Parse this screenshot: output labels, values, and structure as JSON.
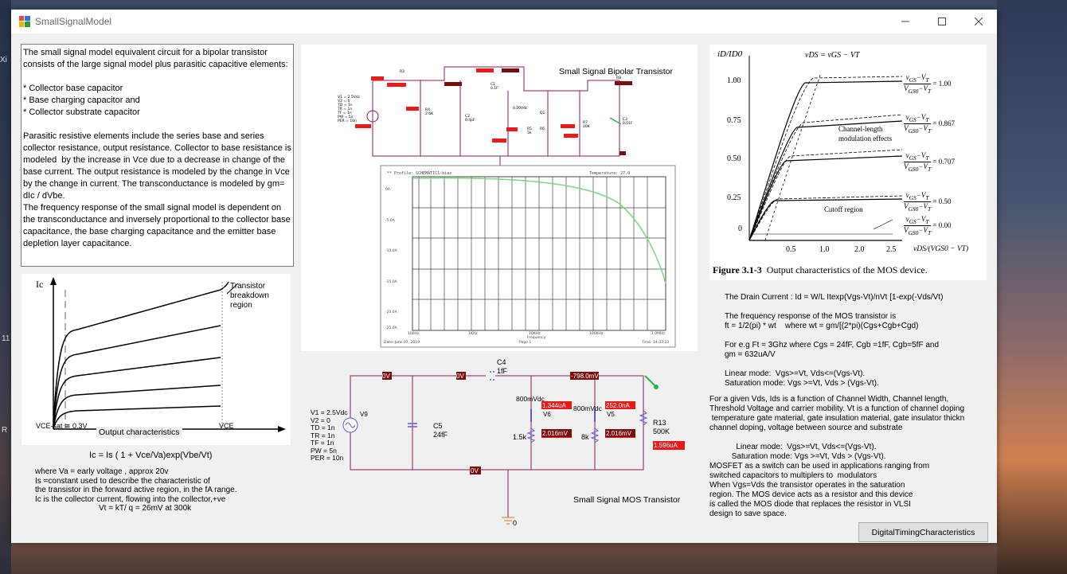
{
  "window": {
    "title": "SmallSignalModel"
  },
  "desktop": {
    "left_labels": [
      "Xi",
      "11",
      "R"
    ]
  },
  "left_text": "The small signal model equivalent circuit for a bipolar transistor consists of the large signal model plus parasitic capacitive elements:\n\n* Collector base capacitor\n* Base charging capacitor and\n* Collector substrate capacitor\n\nParasitic resistive elements include the series base and series collector resistance, output resistance. Collector to base resistance is modeled  by the increase in Vce due to a decrease in change of the base current. The output resistance is modeled by the change in Vce by the change in current. The transconductance is modeled by gm= dIc / dVbe.\nThe frequency response of the small signal model is dependent on the transconductance and inversely proportional to the collector base capacitance, the base charging capacitance and the emitter base depletion layer capacitance.",
  "bjt_graph": {
    "y_label": "Ic",
    "annotation": "Transistor\nbreakdown\nregion",
    "vce_sat": "VCE-sat ≅ 0.3V",
    "x_label": "VCE",
    "caption": "Output characteristics"
  },
  "bjt_notes": {
    "equation": "Ic = Is ( 1 + Vce/Va)exp(Vbe/Vt)",
    "lines": [
      "where Va = early voltage , approx 20v",
      "Is =constant used to describe the characteristic of",
      "the transistor in the forward active region, in the fA range.",
      "Ic is the collector current, flowing into the collector,+ve",
      "Vt = kT/ q = 26mV at 300k"
    ]
  },
  "bjt_circuit": {
    "title": "Small Signal Bipolar Transistor",
    "source_params": "V1 = 2.5Vdc\nV2 = 0\nTD = 1n\nTR = 1n\nTF = 1n\nPW = 5n\nPER = 10n",
    "components": [
      "R3",
      "R4\n2.6K",
      "C1\n0.1F",
      "C2\n0.4pF",
      "0.20Vdc",
      "Q1",
      "R5\n5k",
      "R6",
      "R7\n20K",
      "C3\n0.01F",
      "R8"
    ]
  },
  "simulation_plot": {
    "footer_left": "Date: June 07, 2019",
    "footer_mid": "Page 1",
    "footer_right": "Time: 14:33:23",
    "x_label": "Frequency",
    "x_ticks": [
      "100Hz",
      "1KHz",
      "10KHz",
      "100KHz",
      "1.0MHz"
    ],
    "y_ticks": [
      "0A",
      "-5.0A",
      "-10.0A",
      "-15.0A",
      "-20.0A",
      "-25.0A"
    ]
  },
  "mos_circuit": {
    "title": "Small Signal MOS Transistor",
    "source_params": "V1 = 2.5Vdc\nV2 = 0\nTD = 1n\nTR = 1n\nTF = 1n\nPW = 5n\nPER = 10n",
    "c4": "C4\n1fF",
    "c5": "C5\n24fF",
    "r13": "R13\n500K",
    "v6_label": "800mVdc",
    "v6b_label": "800mVdc",
    "r_1_5k": "1.5k",
    "r_8k": "8k",
    "ground": "0",
    "node_labels": [
      "0V",
      "0V",
      "-798.0mV",
      "0V"
    ],
    "current_labels": [
      "1.344uA",
      "252.0nA",
      "1.596uA"
    ],
    "voltage_labels": [
      "2.016mV",
      "2.016mV"
    ],
    "v9": "V9",
    "v6": "V6",
    "v5": "V5"
  },
  "mos_figure": {
    "y_axis": "iD/ID0",
    "top_label": "vDS = vGS − VT",
    "y_ticks": [
      "1.00",
      "0.75",
      "0.50",
      "0.25",
      "0"
    ],
    "x_ticks": [
      "0.5",
      "1.0",
      "2.0",
      "2.5"
    ],
    "x_axis": "vDS/(VGS0 − VT)",
    "ratios": [
      "= 1.00",
      "= 0.867",
      "= 0.707",
      "= 0.50",
      "= 0.00"
    ],
    "effects": "Channel-length\nmodulation effects",
    "cutoff": "Cutoff region",
    "caption_bold": "Figure 3.1-3",
    "caption": "Output characteristics of the MOS device."
  },
  "mos_notes_1": "The Drain Current : Id = W/L Itexp(Vgs-Vt)/nVt [1-exp(-Vds/Vt)\n\nThe frequency response of the MOS transistor is\nft = 1/2(pi) * wt    where wt = gm/[(2*pi)(Cgs+Cgb+Cgd)\n\nFor e.g Ft = 3Ghz where Cgs = 24fF, Cgb =1fF, Cgb=5fF and\ngm = 632uA/V\n\nLinear mode:  Vgs>=Vt, Vds<=(Vgs-Vt).\nSaturation mode: Vgs >=Vt, Vds > (Vgs-Vt).",
  "mos_notes_2": "For a given Vds, Ids is a function of Channel Width, Channel length,\nThreshold Voltage and carrier mobility. Vt is a function of channel doping\n temperature gate material, gate insulation material, gate insulator thickn\nchannel doping, voltage between source and substrate",
  "mos_notes_3": "            Linear mode:  Vgs>=Vt, Vds<=(Vgs-Vt).\n          Saturation mode: Vgs >=Vt, Vds > (Vgs-Vt).\nMOSFET as a switch can be used in applications ranging from\nswitched capacitors to multiplers to  modulators\nWhen Vgs=Vds the transistor operates in the saturation\nregion. The MOS device acts as a resistor and this device\nis called the MOS diode that replaces the resistor in VLSI\ndesign to save space.",
  "buttons": {
    "digital_timing": "DigitalTimingCharacteristics"
  }
}
